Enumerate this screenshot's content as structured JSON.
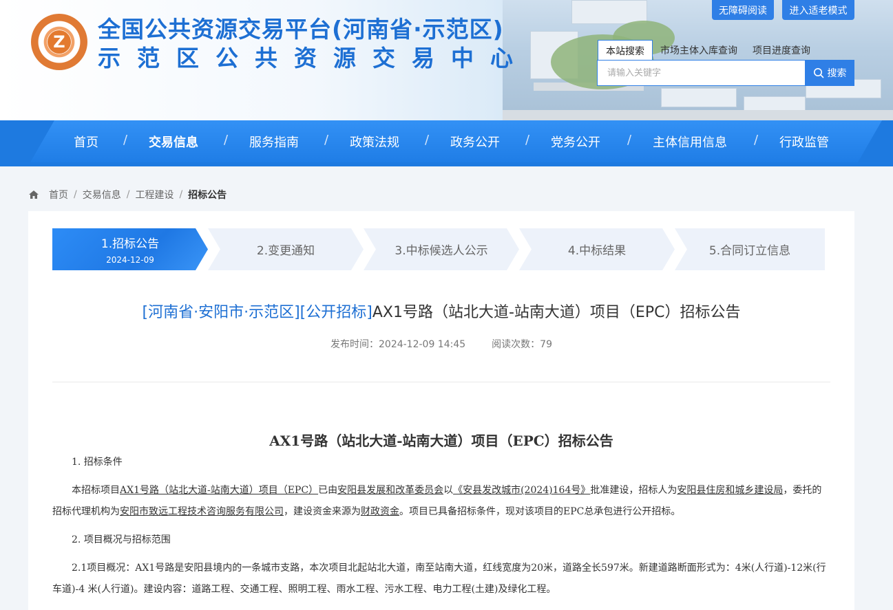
{
  "header": {
    "site_title": "全国公共资源交易平台(河南省·示范区)",
    "site_subtitle": "示范区公共资源交易中心",
    "logo_letter": "Z",
    "accessibility_btn": "无障碍阅读",
    "elder_mode_btn": "进入适老模式",
    "search_tabs": [
      "本站搜索",
      "市场主体入库查询",
      "项目进度查询"
    ],
    "search_placeholder": "请输入关键字",
    "search_btn": "搜索"
  },
  "nav": {
    "items": [
      "首页",
      "交易信息",
      "服务指南",
      "政策法规",
      "政务公开",
      "党务公开",
      "主体信用信息",
      "行政监管"
    ],
    "active_index": 1
  },
  "breadcrumb": [
    "首页",
    "交易信息",
    "工程建设",
    "招标公告"
  ],
  "steps": [
    {
      "label": "1.招标公告",
      "date": "2024-12-09"
    },
    {
      "label": "2.变更通知"
    },
    {
      "label": "3.中标候选人公示"
    },
    {
      "label": "4.中标结果"
    },
    {
      "label": "5.合同订立信息"
    }
  ],
  "article": {
    "tag": "[河南省·安阳市·示范区][公开招标]",
    "title": "AX1号路（站北大道-站南大道）项目（EPC）招标公告",
    "publish_time": "发布时间：2024-12-09 14:45",
    "read_count": "阅读次数：79"
  },
  "doc": {
    "title": "AX1号路（站北大道-站南大道）项目（EPC）招标公告",
    "sec1_heading": "1. 招标条件",
    "sec1_p1_a": "本招标项目",
    "sec1_p1_project": "AX1号路（站北大道-站南大道）项目（EPC）",
    "sec1_p1_b": "已由",
    "sec1_p1_approver": "安阳县发展和改革委员会",
    "sec1_p1_c": "以",
    "sec1_p1_doc": "《安县发改城市(2024)164号》",
    "sec1_p1_d": "批准建设，招标人为",
    "sec1_p1_tenderer": "安阳县住房和城乡建设局",
    "sec1_p1_e": "，委托的招标代理机构为",
    "sec1_p1_agent": "安阳市致远工程技术咨询服务有限公司",
    "sec1_p1_f": "，建设资金来源为",
    "sec1_p1_fund": "财政资金",
    "sec1_p1_g": "。项目已具备招标条件，现对该项目的EPC总承包进行公开招标。",
    "sec2_heading": "2. 项目概况与招标范围",
    "sec2_p1": "2.1项目概况：AX1号路是安阳县境内的一条城市支路，本次项目北起站北大道，南至站南大道，红线宽度为20米，道路全长597米。新建道路断面形式为：4米(人行道)-12米(行车道)-4 米(人行道)。建设内容：道路工程、交通工程、照明工程、雨水工程、污水工程、电力工程(土建)及绿化工程。"
  },
  "colors": {
    "brand_blue": "#1d6fd3",
    "nav_blue": "#1f7de6",
    "logo_orange": "#e07a34"
  }
}
